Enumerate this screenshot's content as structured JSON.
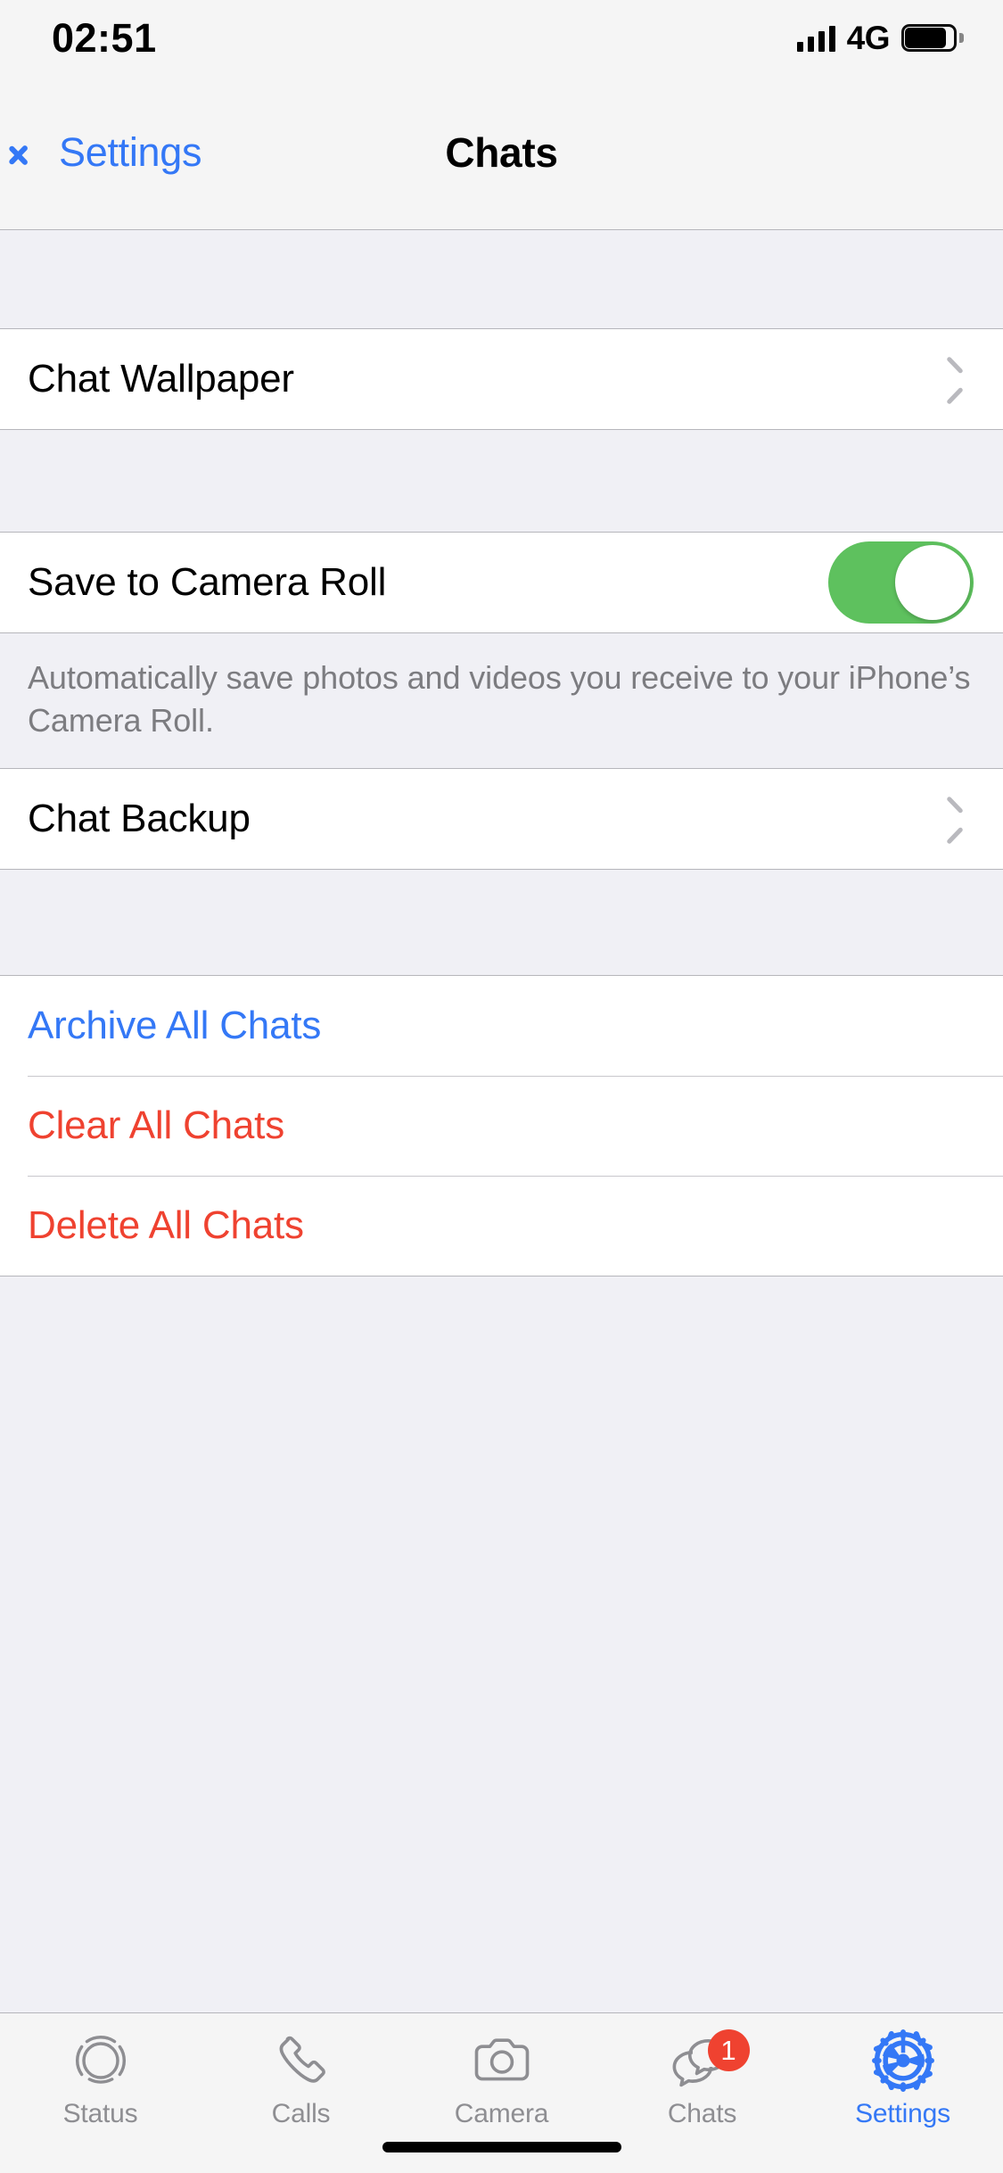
{
  "status_bar": {
    "time": "02:51",
    "network": "4G",
    "signal_icon": "signal-bars-icon",
    "battery_icon": "battery-icon"
  },
  "nav_bar": {
    "back_label": "Settings",
    "back_icon": "chevron-left-icon",
    "title": "Chats"
  },
  "sections": [
    {
      "rows": [
        {
          "label": "Chat Wallpaper",
          "type": "disclosure",
          "accessory_icon": "chevron-right-icon",
          "style": "default"
        }
      ],
      "footer": ""
    },
    {
      "rows": [
        {
          "label": "Save to Camera Roll",
          "type": "toggle",
          "toggle_on": true,
          "style": "default"
        }
      ],
      "footer": "Automatically save photos and videos you receive to your iPhone’s Camera Roll."
    },
    {
      "rows": [
        {
          "label": "Chat Backup",
          "type": "disclosure",
          "accessory_icon": "chevron-right-icon",
          "style": "default"
        }
      ],
      "footer": ""
    },
    {
      "rows": [
        {
          "label": "Archive All Chats",
          "type": "action",
          "style": "blue"
        },
        {
          "label": "Clear All Chats",
          "type": "action",
          "style": "red"
        },
        {
          "label": "Delete All Chats",
          "type": "action",
          "style": "red"
        }
      ],
      "footer": ""
    }
  ],
  "tab_bar": {
    "tabs": [
      {
        "label": "Status",
        "icon": "status-rings-icon",
        "active": false,
        "badge": ""
      },
      {
        "label": "Calls",
        "icon": "phone-icon",
        "active": false,
        "badge": ""
      },
      {
        "label": "Camera",
        "icon": "camera-icon",
        "active": false,
        "badge": ""
      },
      {
        "label": "Chats",
        "icon": "chat-bubbles-icon",
        "active": false,
        "badge": "1"
      },
      {
        "label": "Settings",
        "icon": "gear-icon",
        "active": true,
        "badge": ""
      }
    ]
  },
  "colors": {
    "accent_blue": "#3478f6",
    "destructive_red": "#ef4230",
    "toggle_on_green": "#5ec15e",
    "badge_red": "#ef4230",
    "table_background": "#f0f0f5",
    "cell_background": "#ffffff",
    "bar_background": "#f5f5f5",
    "secondary_text": "#7c7c80"
  }
}
